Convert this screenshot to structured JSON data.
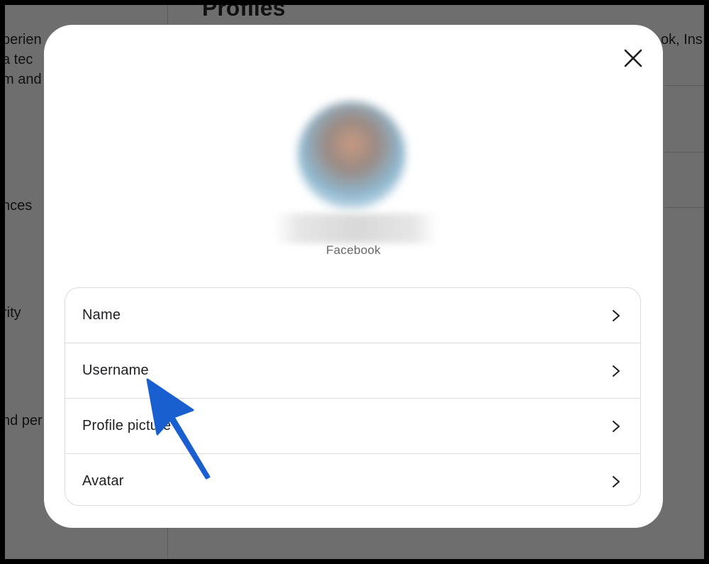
{
  "background": {
    "page_title": "Profiles",
    "fragments": [
      "perien",
      "a tec",
      "m and",
      "nces",
      "rity",
      "nd per",
      "ok, Ins"
    ]
  },
  "modal": {
    "close_label": "Close",
    "account_source": "Facebook",
    "menu_items": [
      {
        "label": "Name"
      },
      {
        "label": "Username"
      },
      {
        "label": "Profile picture"
      },
      {
        "label": "Avatar"
      }
    ]
  },
  "icons": {
    "close": "close-icon",
    "chevron": "chevron-right-icon",
    "annotation": "pointer-arrow-icon"
  },
  "colors": {
    "annotation_arrow": "#1a5fd0",
    "overlay": "#6e6e6e",
    "secondary_text": "#65676b"
  }
}
